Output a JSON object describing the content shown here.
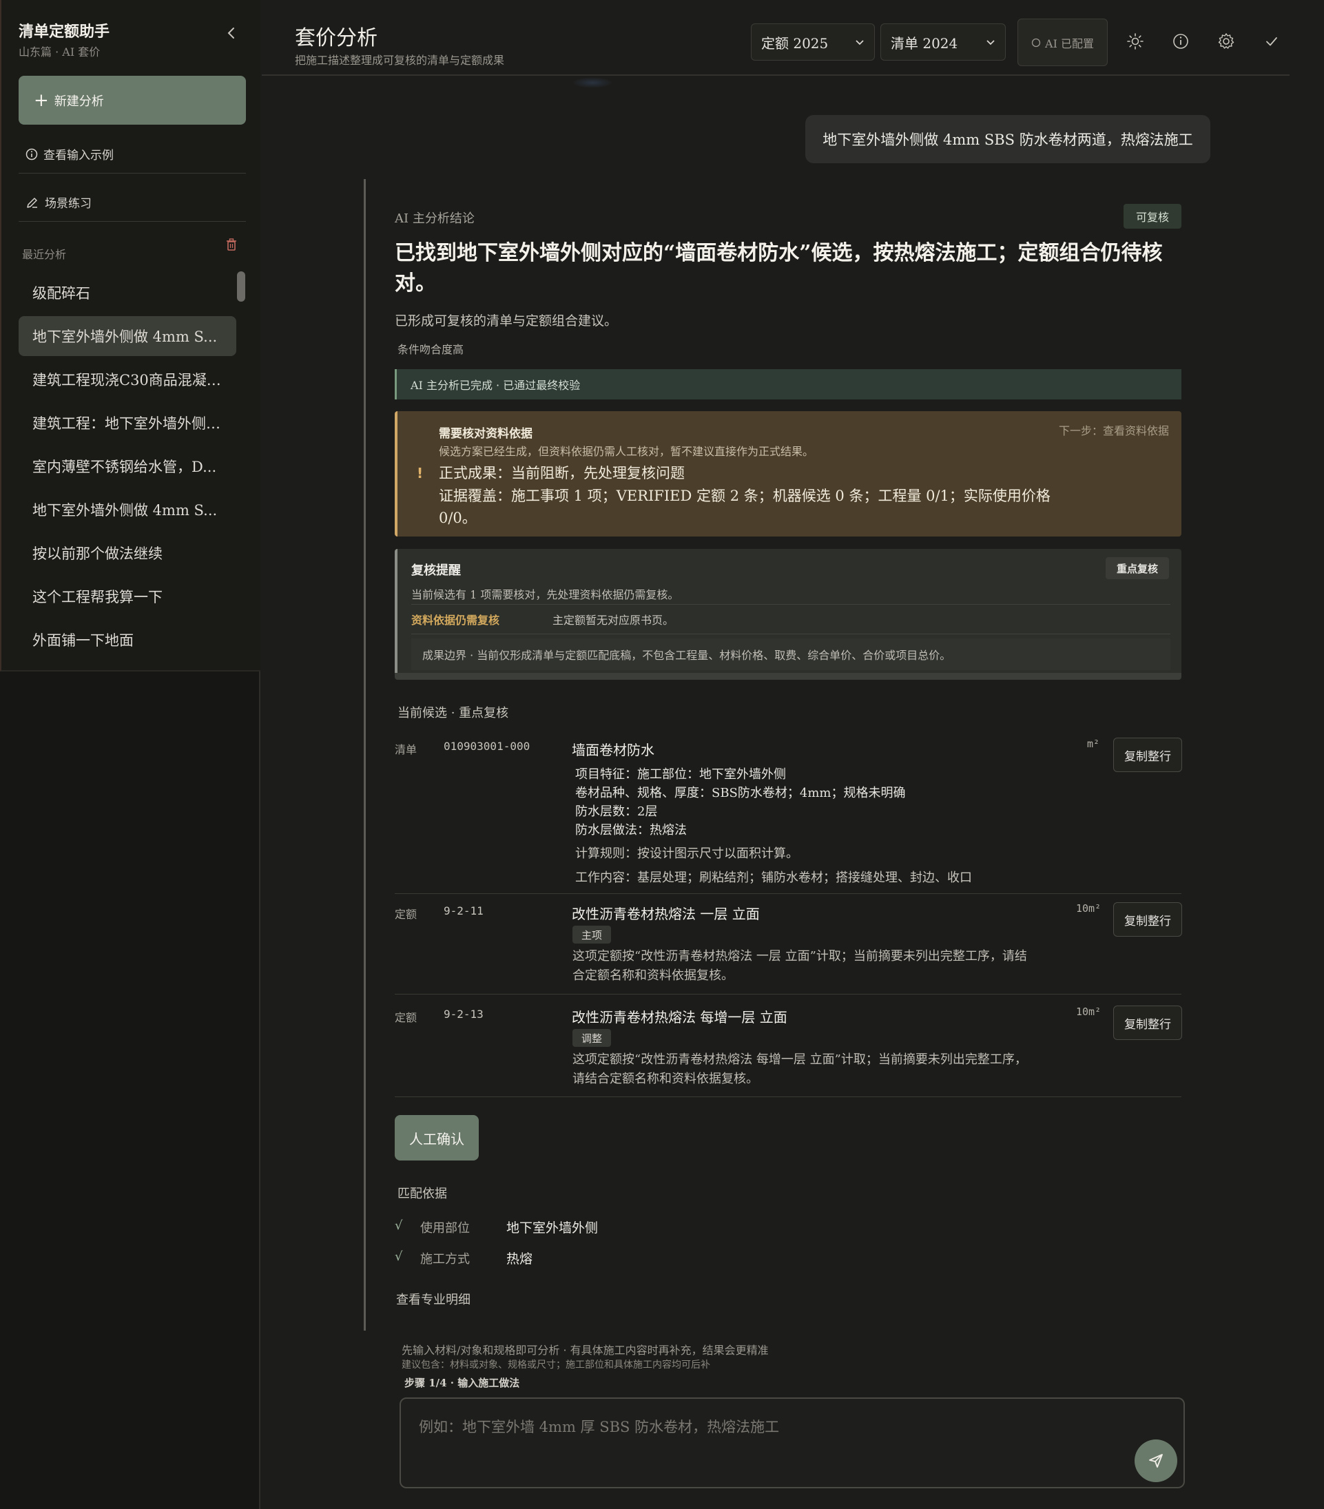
{
  "sidebar": {
    "app_title": "清单定额助手",
    "app_subtitle": "山东篇 · AI 套价",
    "new_analysis": "新建分析",
    "view_examples": "查看输入示例",
    "scenario_practice": "场景练习",
    "recent_label": "最近分析",
    "recent_items": [
      "级配碎石",
      "地下室外墙外侧做 4mm S...",
      "建筑工程现浇C30商品混凝…",
      "建筑工程：地下室外墙外侧…",
      "室内薄壁不锈钢给水管，D...",
      "地下室外墙外侧做 4mm S...",
      "按以前那个做法继续",
      "这个工程帮我算一下",
      "外面铺一下地面"
    ],
    "active_index": 1
  },
  "header": {
    "title": "套价分析",
    "subtitle": "把施工描述整理成可复核的清单与定额成果",
    "quota_select": "定额 2025",
    "bill_select": "清单 2024",
    "ai_status": "AI 已配置",
    "icons": [
      "sun-icon",
      "info-icon",
      "gear-icon",
      "check-icon"
    ]
  },
  "chat": {
    "user_message": "地下室外墙外侧做 4mm SBS 防水卷材两道，热熔法施工"
  },
  "result": {
    "section_label": "AI 主分析结论",
    "badge": "可复核",
    "conclusion": "已找到地下室外墙外侧对应的“墙面卷材防水”候选，按热熔法施工；定额组合仍待核对。",
    "description": "已形成可复核的清单与定额组合建议。",
    "match_level": "条件吻合度高",
    "status_bar": "AI 主分析已完成 · 已通过最终校验",
    "warning": {
      "title": "需要核对资料依据",
      "next_step": "下一步：查看资料依据",
      "line1": "候选方案已经生成，但资料依据仍需人工核对，暂不建议直接作为正式结果。",
      "line2": "正式成果：当前阻断，先处理复核问题",
      "line3": "证据覆盖：施工事项 1 项；VERIFIED 定额 2 条；机器候选 0 条；工程量 0/1；实际使用价格 0/0。",
      "mark": "!"
    },
    "review": {
      "title": "复核提醒",
      "badge": "重点复核",
      "desc": "当前候选有 1 项需要核对，先处理资料依据仍需复核。",
      "key": "资料依据仍需复核",
      "value": "主定额暂无对应原书页。",
      "boundary": "成果边界 · 当前仅形成清单与定额匹配底稿，不包含工程量、材料价格、取费、综合单价、合价或项目总价。"
    },
    "candidates_title": "当前候选 · 重点复核",
    "copy_label": "复制整行",
    "bill_item": {
      "kind": "清单",
      "code": "010903001-000",
      "name": "墙面卷材防水",
      "unit": "m²",
      "features": [
        "项目特征：施工部位：地下室外墙外侧",
        "卷材品种、规格、厚度：SBS防水卷材；4mm；规格未明确",
        "防水层数：2层",
        "防水层做法：热熔法"
      ],
      "rule": "计算规则：按设计图示尺寸以面积计算。",
      "work": "工作内容：基层处理；刷粘结剂；铺防水卷材；搭接缝处理、封边、收口"
    },
    "quota_items": [
      {
        "kind": "定额",
        "code": "9-2-11",
        "name": "改性沥青卷材热熔法 一层 立面",
        "unit": "10m²",
        "tag": "主项",
        "note": "这项定额按“改性沥青卷材热熔法 一层 立面”计取；当前摘要未列出完整工序，请结合定额名称和资料依据复核。"
      },
      {
        "kind": "定额",
        "code": "9-2-13",
        "name": "改性沥青卷材热熔法 每增一层 立面",
        "unit": "10m²",
        "tag": "调整",
        "note": "这项定额按“改性沥青卷材热熔法 每增一层 立面”计取；当前摘要未列出完整工序，请结合定额名称和资料依据复核。"
      }
    ],
    "confirm_button": "人工确认",
    "basis_title": "匹配依据",
    "basis": [
      {
        "check": "√",
        "key": "使用部位",
        "value": "地下室外墙外侧"
      },
      {
        "check": "√",
        "key": "施工方式",
        "value": "热熔"
      }
    ],
    "pro_detail": "查看专业明细"
  },
  "composer": {
    "hint1": "先输入材料/对象和规格即可分析 · 有具体施工内容时再补充，结果会更精准",
    "hint2": "建议包含：材料或对象、规格或尺寸；施工部位和具体施工内容均可后补",
    "step": "步骤 1/4 · 输入施工做法",
    "placeholder": "例如：地下室外墙 4mm 厚 SBS 防水卷材，热熔法施工"
  },
  "colors": {
    "accent": "#6a7a6a",
    "warning": "#d2a867",
    "background": "#1c1c1a"
  }
}
